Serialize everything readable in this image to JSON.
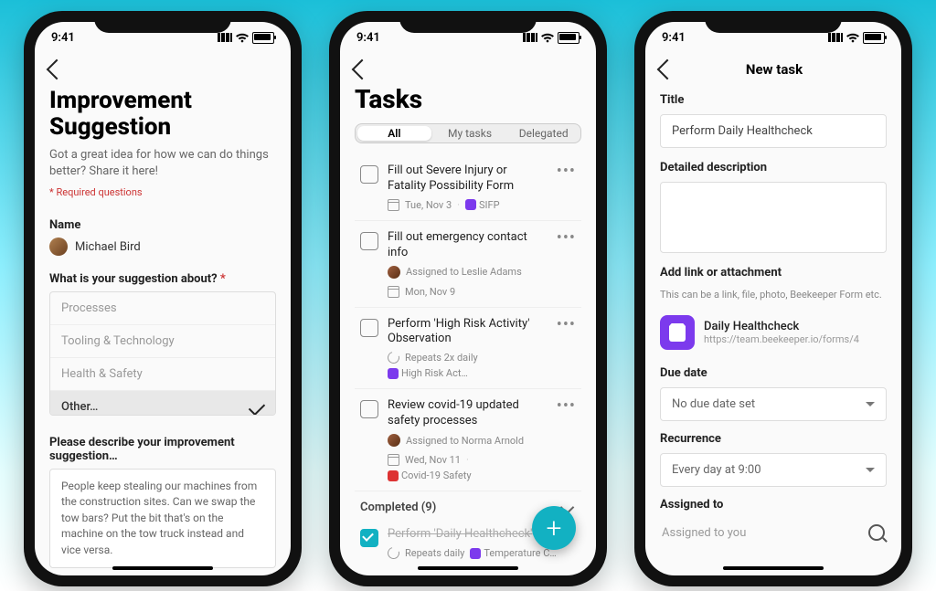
{
  "status": {
    "time": "9:41"
  },
  "phone1": {
    "title_line1": "Improvement",
    "title_line2": "Suggestion",
    "subtitle": "Got a great idea for how we can do things better? Share it here!",
    "required_note": "* Required questions",
    "name_label": "Name",
    "name_value": "Michael Bird",
    "q1_label": "What is your suggestion about? ",
    "q1_asterisk": "*",
    "options": [
      {
        "label": "Processes",
        "selected": false
      },
      {
        "label": "Tooling & Technology",
        "selected": false
      },
      {
        "label": "Health & Safety",
        "selected": false
      },
      {
        "label": "Other…",
        "selected": true
      }
    ],
    "q2_label": "Please describe your improvement suggestion…",
    "q2_value": "People keep stealing our machines from the construction sites. Can we swap the tow bars? Put the bit that's on the machine on the tow truck instead and vice versa."
  },
  "phone2": {
    "title": "Tasks",
    "tabs": [
      "All",
      "My tasks",
      "Delegated"
    ],
    "active_tab": 0,
    "tasks": [
      {
        "title": "Fill out Severe Injury or Fatality Possibility Form",
        "meta": [
          {
            "icon": "cal",
            "text": "Tue, Nov 3"
          },
          {
            "icon": "chip",
            "text": "SIFP"
          }
        ]
      },
      {
        "title": "Fill out emergency contact info",
        "meta": [
          {
            "icon": "avatar",
            "text": "Assigned to Leslie Adams"
          },
          {
            "break": true
          },
          {
            "icon": "cal",
            "text": "Mon, Nov 9"
          }
        ]
      },
      {
        "title": "Perform 'High Risk Activity' Observation",
        "meta": [
          {
            "icon": "repeat",
            "text": "Repeats 2x daily"
          },
          {
            "icon": "chip",
            "text": "High Risk Act…"
          }
        ]
      },
      {
        "title": "Review covid-19 updated safety processes",
        "meta": [
          {
            "icon": "avatar",
            "text": "Assigned to Norma Arnold"
          },
          {
            "break": true
          },
          {
            "icon": "cal",
            "text": "Wed, Nov 11"
          },
          {
            "icon": "chipred",
            "text": "Covid-19 Safety"
          }
        ]
      }
    ],
    "completed_header": "Completed (9)",
    "completed_task": {
      "title": "Perform 'Daily Healthcheck'",
      "meta": [
        {
          "icon": "repeat",
          "text": "Repeats daily"
        },
        {
          "icon": "chip",
          "text": "Temperature C…"
        }
      ]
    }
  },
  "phone3": {
    "header": "New task",
    "title_label": "Title",
    "title_value": "Perform Daily Healthcheck",
    "desc_label": "Detailed description",
    "desc_value": "",
    "attach_label": "Add link or attachment",
    "attach_helper": "This can be a link, file, photo, Beekeeper Form etc.",
    "attach_title": "Daily Healthcheck",
    "attach_url": "https://team.beekeeper.io/forms/4",
    "due_label": "Due date",
    "due_value": "No due date set",
    "recur_label": "Recurrence",
    "recur_value": "Every day at 9:00",
    "assigned_label": "Assigned to",
    "assigned_value": "Assigned to you"
  }
}
